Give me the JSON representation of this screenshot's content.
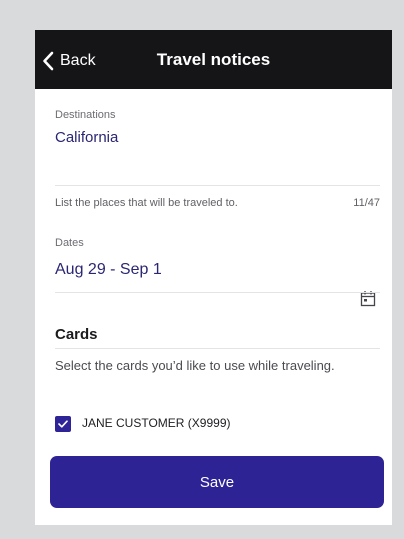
{
  "navbar": {
    "back_label": "Back",
    "title": "Travel notices"
  },
  "destinations": {
    "label": "Destinations",
    "value": "California",
    "helper": "List the places that will be traveled to.",
    "counter": "11/47"
  },
  "dates": {
    "label": "Dates",
    "value": "Aug 29 - Sep 1",
    "icon": "calendar-icon"
  },
  "cards": {
    "title": "Cards",
    "description": "Select the cards you’d like to use while traveling.",
    "items": [
      {
        "label": "JANE CUSTOMER (X9999)",
        "checked": true
      }
    ]
  },
  "actions": {
    "save_label": "Save"
  },
  "colors": {
    "accent": "#2d2395",
    "navbar": "#151518",
    "value_text": "#2a2673"
  }
}
